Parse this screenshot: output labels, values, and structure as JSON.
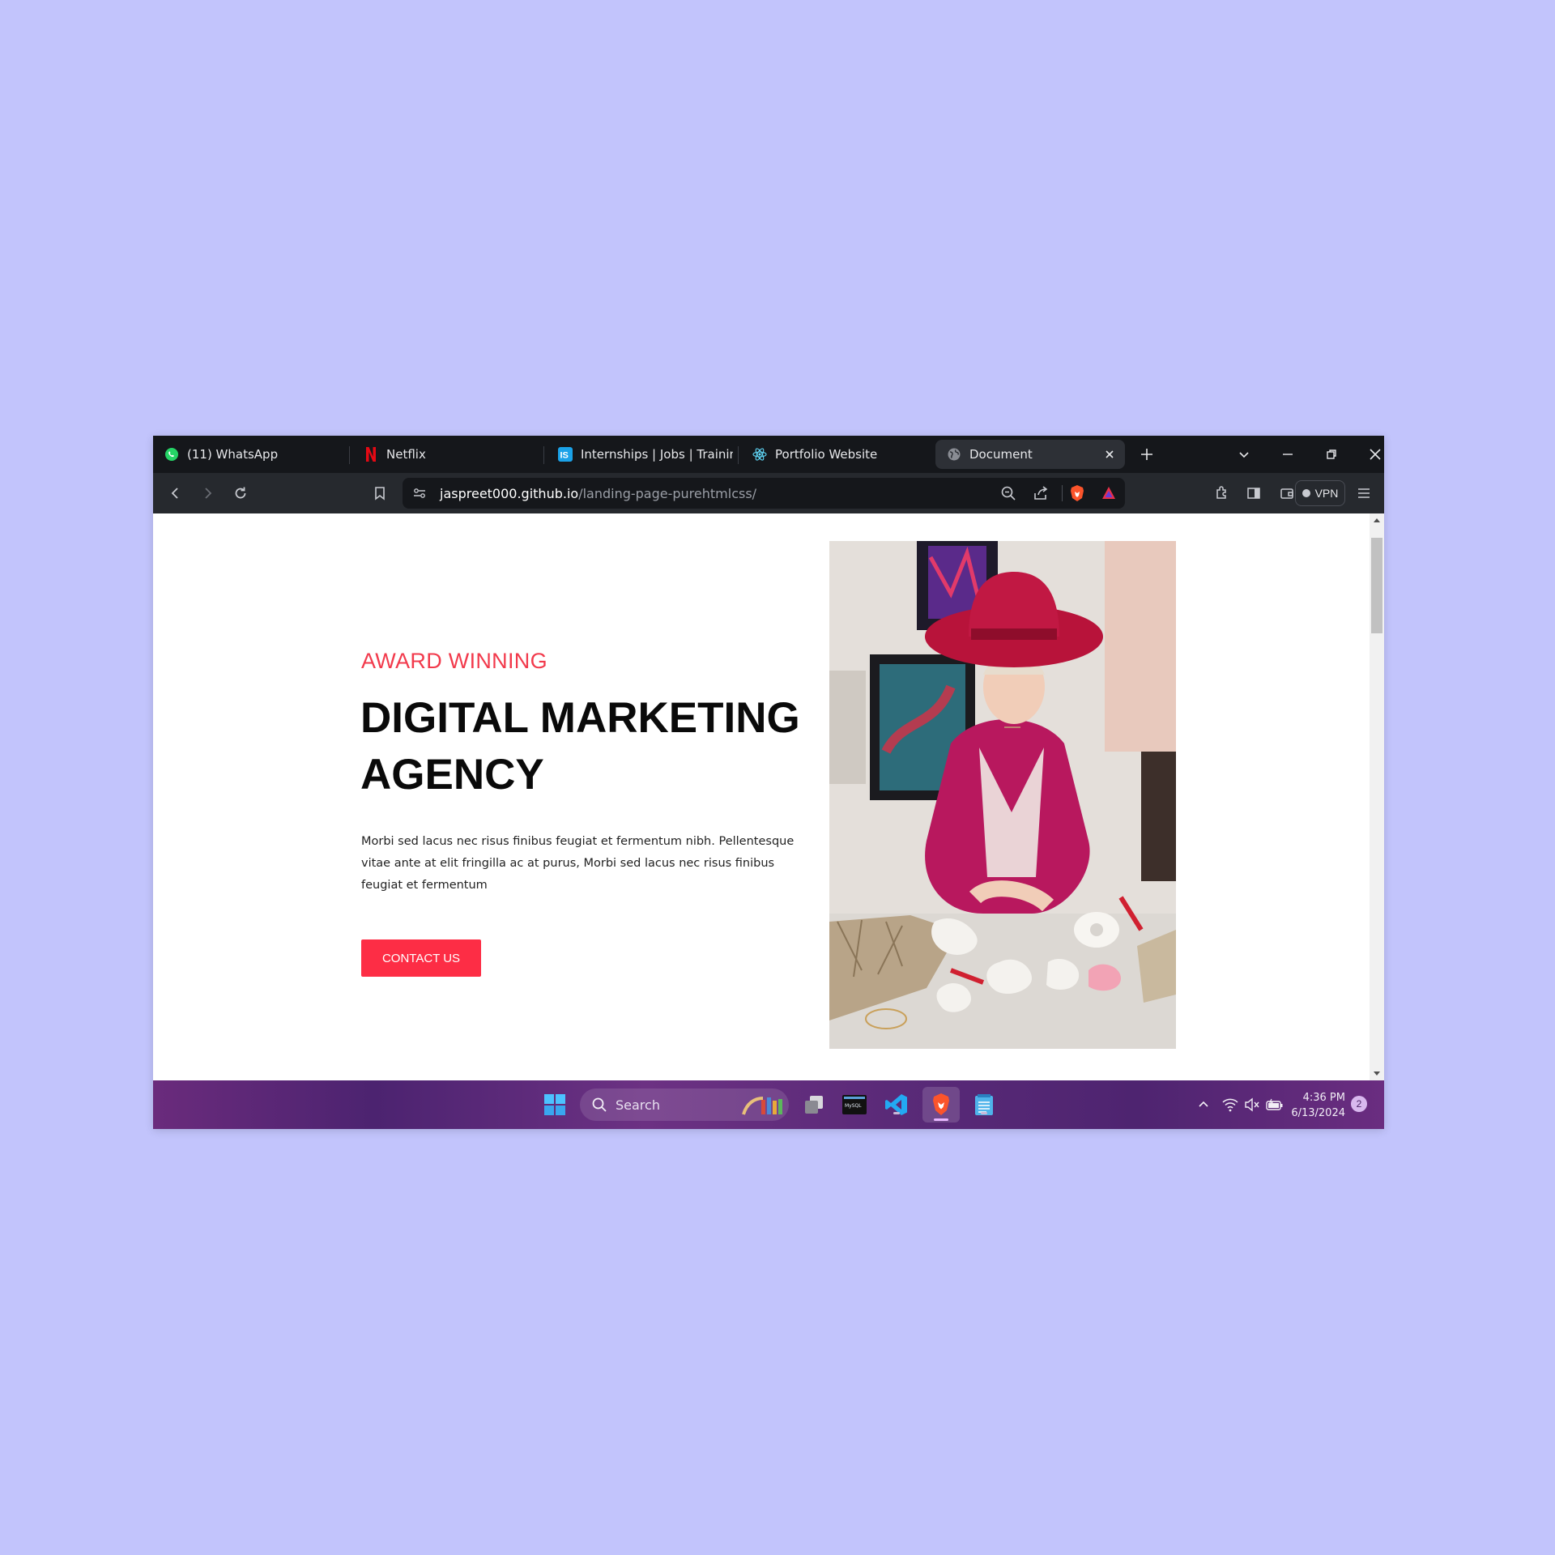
{
  "browser": {
    "tabs": [
      {
        "title": "(11) WhatsApp",
        "icon": "whatsapp-icon"
      },
      {
        "title": "Netflix",
        "icon": "netflix-icon"
      },
      {
        "title": "Internships | Jobs | Trainings &",
        "icon": "internshala-icon"
      },
      {
        "title": "Portfolio Website",
        "icon": "react-icon"
      },
      {
        "title": "Document",
        "icon": "globe-icon",
        "active": true
      }
    ],
    "url": {
      "host": "jaspreet000.github.io",
      "path": "/landing-page-purehtmlcss/"
    },
    "vpn_label": "VPN"
  },
  "page": {
    "subheading": "AWARD WINNING",
    "heading": "DIGITAL MARKETING AGENCY",
    "paragraph": "Morbi sed lacus nec risus finibus feugiat et fermentum nibh. Pellentesque vitae ante at elit fringilla ac at purus, Morbi sed lacus nec risus finibus feugiat et fermentum",
    "cta_label": "CONTACT US",
    "accent_color": "#fd2d45"
  },
  "taskbar": {
    "search_label": "Search",
    "time": "4:36 PM",
    "date": "6/13/2024",
    "notification_count": "2"
  }
}
